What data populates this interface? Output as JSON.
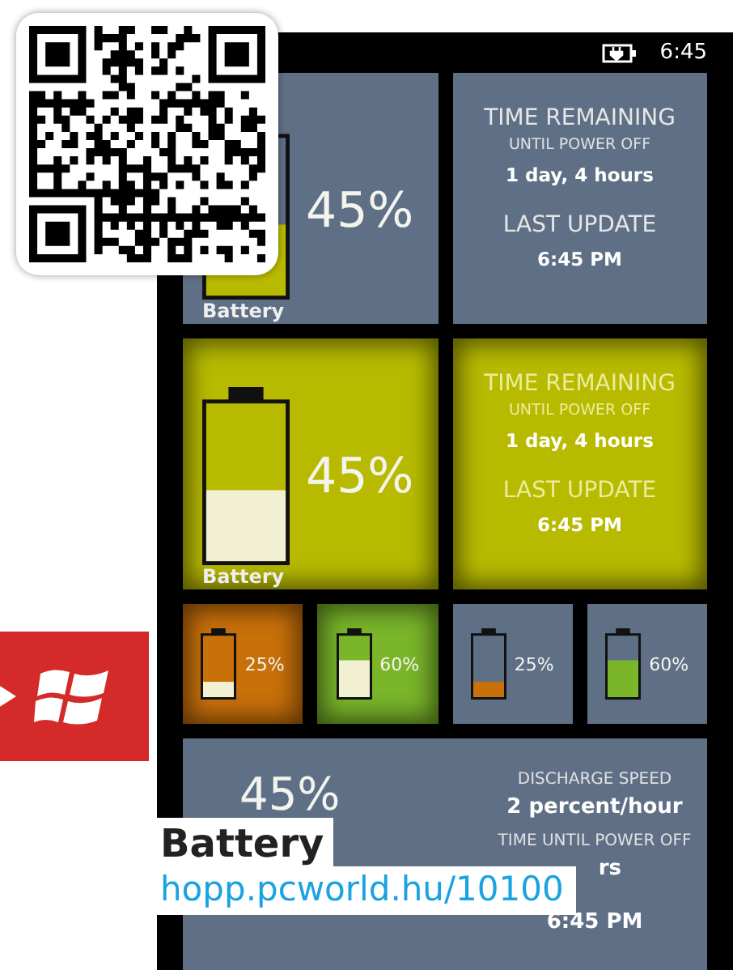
{
  "status_bar": {
    "time": "6:45"
  },
  "tiles": [
    {
      "kind": "large_battery",
      "filled": false,
      "color": "#b8ba00",
      "level": 0.45,
      "percent": "45%",
      "label": "Battery"
    },
    {
      "kind": "info",
      "filled": false,
      "lines": [
        {
          "kind": "heading",
          "text": "TIME REMAINING"
        },
        {
          "kind": "sub",
          "text": "UNTIL POWER OFF"
        },
        {
          "kind": "value",
          "text": "1 day, 4 hours"
        },
        {
          "kind": "heading",
          "text": "LAST UPDATE"
        },
        {
          "kind": "value",
          "text": "6:45 PM"
        }
      ]
    },
    {
      "kind": "large_battery",
      "filled": true,
      "color": "#b8ba00",
      "level": 0.45,
      "percent": "45%",
      "label": "Battery"
    },
    {
      "kind": "info",
      "filled": true,
      "color": "#b8ba00",
      "lines": [
        {
          "kind": "heading",
          "text": "TIME REMAINING"
        },
        {
          "kind": "sub",
          "text": "UNTIL POWER OFF"
        },
        {
          "kind": "value",
          "text": "1 day, 4 hours"
        },
        {
          "kind": "heading",
          "text": "LAST UPDATE"
        },
        {
          "kind": "value",
          "text": "6:45 PM"
        }
      ]
    },
    {
      "kind": "small_battery",
      "filled": true,
      "color": "#c8700a",
      "level": 0.25,
      "percent": "25%"
    },
    {
      "kind": "small_battery",
      "filled": true,
      "color": "#7ab52a",
      "level": 0.6,
      "percent": "60%"
    },
    {
      "kind": "small_battery",
      "filled": false,
      "color": "#c8700a",
      "level": 0.25,
      "percent": "25%"
    },
    {
      "kind": "small_battery",
      "filled": false,
      "color": "#7ab52a",
      "level": 0.6,
      "percent": "60%"
    },
    {
      "kind": "detail",
      "filled": false,
      "percent": "45%",
      "lines": [
        {
          "kind": "sub",
          "text": "DISCHARGE SPEED"
        },
        {
          "kind": "value",
          "text": "2 percent/hour"
        },
        {
          "kind": "sub",
          "text": "TIME UNTIL POWER OFF"
        },
        {
          "kind": "partial",
          "text": "rs"
        },
        {
          "kind": "value",
          "text": "6:45 PM"
        }
      ]
    }
  ],
  "caption": {
    "title": "Battery",
    "link": "hopp.pcworld.hu/10100"
  }
}
